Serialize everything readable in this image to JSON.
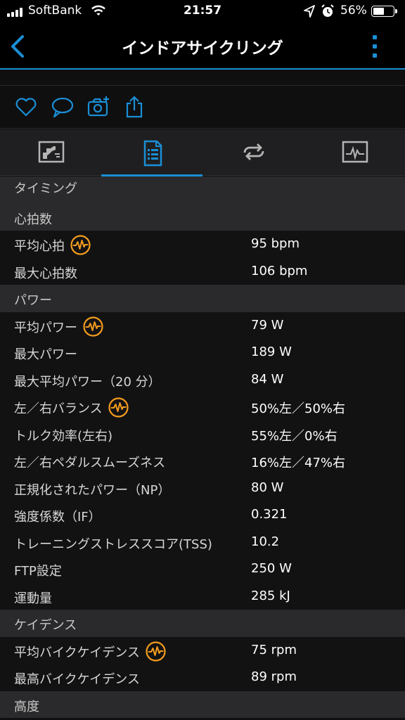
{
  "status_bar": {
    "carrier": "SoftBank",
    "time": "21:57",
    "battery_percent_label": "56%",
    "battery_level": 0.56
  },
  "nav": {
    "title": "インドアサイクリング"
  },
  "actions": [
    "heart-icon",
    "comment-icon",
    "add-photo-icon",
    "share-icon"
  ],
  "tabs": [
    {
      "icon": "summary-chart-icon",
      "active": false
    },
    {
      "icon": "stats-list-icon",
      "active": true
    },
    {
      "icon": "laps-icon",
      "active": false
    },
    {
      "icon": "graph-icon",
      "active": false
    }
  ],
  "rows": [
    {
      "type": "section",
      "label": "タイミング"
    },
    {
      "type": "section",
      "label": "心拍数"
    },
    {
      "type": "data",
      "label": "平均心拍",
      "value": "95 bpm",
      "badge": true
    },
    {
      "type": "data",
      "label": "最大心拍数",
      "value": "106 bpm",
      "badge": false
    },
    {
      "type": "section",
      "label": "パワー"
    },
    {
      "type": "data",
      "label": "平均パワー",
      "value": "79 W",
      "badge": true
    },
    {
      "type": "data",
      "label": "最大パワー",
      "value": "189 W",
      "badge": false
    },
    {
      "type": "data",
      "label": "最大平均パワー（20 分）",
      "value": "84 W",
      "badge": false
    },
    {
      "type": "data",
      "label": "左／右バランス",
      "value": "50%左／50%右",
      "badge": true
    },
    {
      "type": "data",
      "label": "トルク効率(左右)",
      "value": "55%左／0%右",
      "badge": false
    },
    {
      "type": "data",
      "label": "左／右ペダルスムーズネス",
      "value": "16%左／47%右",
      "badge": false
    },
    {
      "type": "data",
      "label": "正規化されたパワー（NP）",
      "value": "80 W",
      "badge": false
    },
    {
      "type": "data",
      "label": "強度係数（IF）",
      "value": "0.321",
      "badge": false
    },
    {
      "type": "data",
      "label": "トレーニングストレススコア(TSS)",
      "value": "10.2",
      "badge": false
    },
    {
      "type": "data",
      "label": "FTP設定",
      "value": "250 W",
      "badge": false
    },
    {
      "type": "data",
      "label": "運動量",
      "value": "285 kJ",
      "badge": false
    },
    {
      "type": "section",
      "label": "ケイデンス"
    },
    {
      "type": "data",
      "label": "平均バイクケイデンス",
      "value": "75 rpm",
      "badge": true
    },
    {
      "type": "data",
      "label": "最高バイクケイデンス",
      "value": "89 rpm",
      "badge": false
    },
    {
      "type": "section",
      "label": "高度"
    }
  ],
  "colors": {
    "accent": "#1a8fd6",
    "badge": "#f39c1e",
    "section_bg": "#2a2a2c",
    "row_bg": "#121213"
  }
}
